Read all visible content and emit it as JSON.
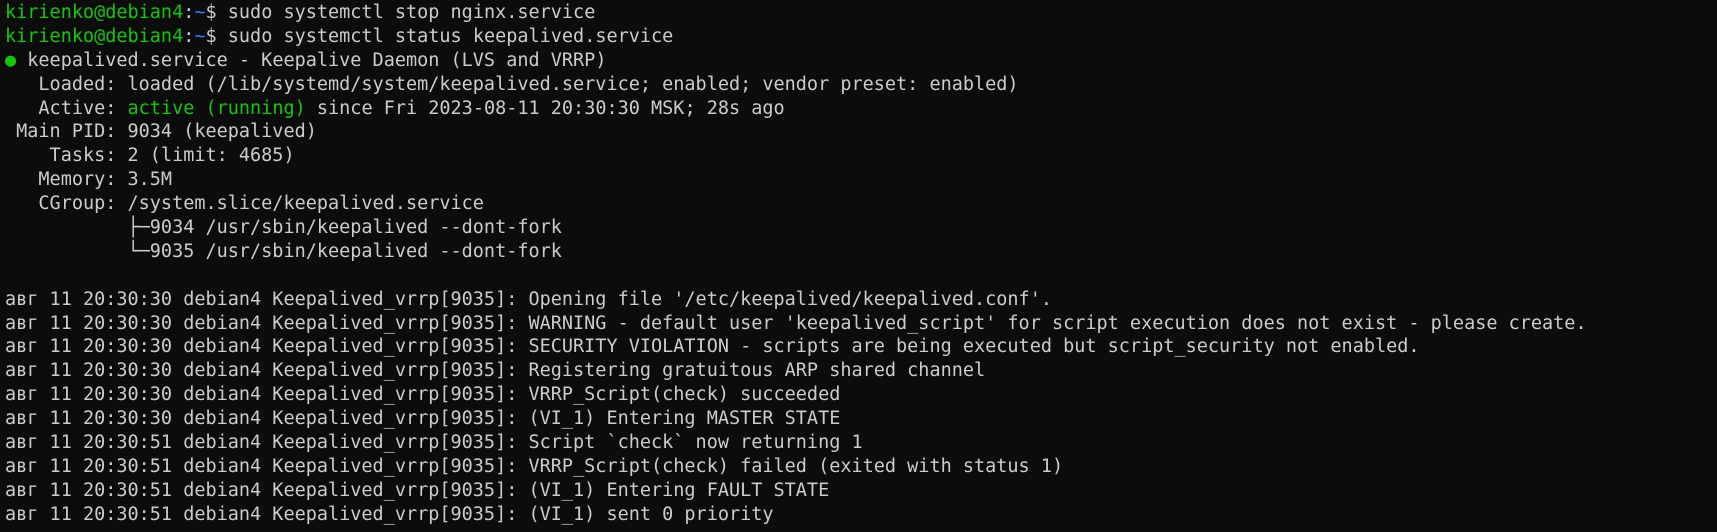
{
  "colors": {
    "background": "#0c0c0c",
    "text": "#cccccc",
    "prompt_user": "#16c60c",
    "prompt_path": "#3b78ff",
    "status_active": "#16c60c"
  },
  "prompts": [
    {
      "user": "kirienko@debian4",
      "sep": ":",
      "path": "~",
      "symbol": "$ ",
      "command": "sudo systemctl stop nginx.service"
    },
    {
      "user": "kirienko@debian4",
      "sep": ":",
      "path": "~",
      "symbol": "$ ",
      "command": "sudo systemctl status keepalived.service"
    }
  ],
  "status": {
    "dot": "●",
    "header": " keepalived.service - Keepalive Daemon (LVS and VRRP)",
    "loaded": "   Loaded: loaded (/lib/systemd/system/keepalived.service; enabled; vendor preset: enabled)",
    "active_label": "   Active: ",
    "active_state": "active (running)",
    "active_rest": " since Fri 2023-08-11 20:30:30 MSK; 28s ago",
    "main_pid": " Main PID: 9034 (keepalived)",
    "tasks": "    Tasks: 2 (limit: 4685)",
    "memory": "   Memory: 3.5M",
    "cgroup": "   CGroup: /system.slice/keepalived.service",
    "cgroup_children": [
      "           ├─9034 /usr/sbin/keepalived --dont-fork",
      "           └─9035 /usr/sbin/keepalived --dont-fork"
    ]
  },
  "log_lines": [
    "авг 11 20:30:30 debian4 Keepalived_vrrp[9035]: Opening file '/etc/keepalived/keepalived.conf'.",
    "авг 11 20:30:30 debian4 Keepalived_vrrp[9035]: WARNING - default user 'keepalived_script' for script execution does not exist - please create.",
    "авг 11 20:30:30 debian4 Keepalived_vrrp[9035]: SECURITY VIOLATION - scripts are being executed but script_security not enabled.",
    "авг 11 20:30:30 debian4 Keepalived_vrrp[9035]: Registering gratuitous ARP shared channel",
    "авг 11 20:30:30 debian4 Keepalived_vrrp[9035]: VRRP_Script(check) succeeded",
    "авг 11 20:30:30 debian4 Keepalived_vrrp[9035]: (VI_1) Entering MASTER STATE",
    "авг 11 20:30:51 debian4 Keepalived_vrrp[9035]: Script `check` now returning 1",
    "авг 11 20:30:51 debian4 Keepalived_vrrp[9035]: VRRP_Script(check) failed (exited with status 1)",
    "авг 11 20:30:51 debian4 Keepalived_vrrp[9035]: (VI_1) Entering FAULT STATE",
    "авг 11 20:30:51 debian4 Keepalived_vrrp[9035]: (VI_1) sent 0 priority"
  ]
}
